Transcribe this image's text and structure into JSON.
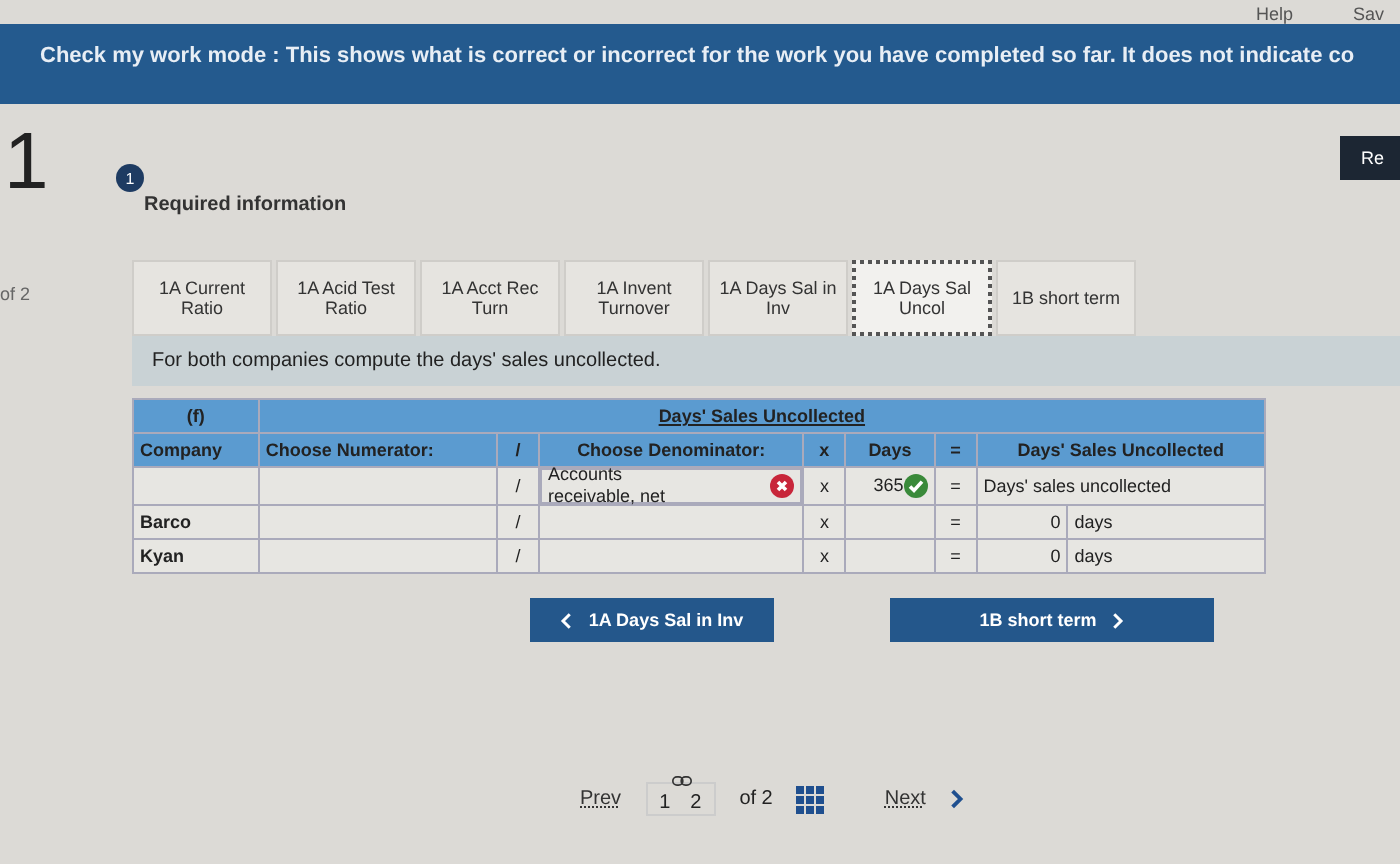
{
  "top_links": [
    "Help",
    "Sav"
  ],
  "banner": "Check my work mode : This shows what is correct or incorrect for the work you have completed so far. It does not indicate co",
  "question": {
    "number": "1",
    "position": "of 2"
  },
  "top_button": "Re",
  "info": {
    "badge": "1",
    "label": "Required information"
  },
  "tabs": [
    {
      "label": "1A Current Ratio",
      "selected": false
    },
    {
      "label": "1A Acid Test Ratio",
      "selected": false
    },
    {
      "label": "1A Acct Rec Turn",
      "selected": false
    },
    {
      "label": "1A Invent Turnover",
      "selected": false
    },
    {
      "label": "1A Days Sal in Inv",
      "selected": false
    },
    {
      "label": "1A Days Sal Uncol",
      "selected": true
    },
    {
      "label": "1B short term",
      "selected": false
    }
  ],
  "instruction": "For both companies compute the days' sales uncollected.",
  "table": {
    "part": "(f)",
    "title": "Days' Sales Uncollected",
    "columns": [
      "Company",
      "Choose Numerator:",
      "/",
      "Choose Denominator:",
      "x",
      "Days",
      "=",
      "Days' Sales Uncollected"
    ],
    "formula_row": {
      "slash": "/",
      "denominator": {
        "text": "Accounts receivable, net",
        "correct": false
      },
      "times": "x",
      "days": {
        "text": "365",
        "correct": true
      },
      "equals": "=",
      "result": "Days' sales uncollected"
    },
    "rows": [
      {
        "company": "Barco",
        "slash": "/",
        "times": "x",
        "equals": "=",
        "value": "0",
        "unit": "days"
      },
      {
        "company": "Kyan",
        "slash": "/",
        "times": "x",
        "equals": "=",
        "value": "0",
        "unit": "days"
      }
    ]
  },
  "nav_buttons": [
    {
      "label": "1A Days Sal in Inv",
      "kind": "prev"
    },
    {
      "label": "1B short term",
      "kind": "next"
    }
  ],
  "pager": {
    "prev": "Prev",
    "pages": [
      "1",
      "2"
    ],
    "total": "of 2",
    "next": "Next"
  }
}
